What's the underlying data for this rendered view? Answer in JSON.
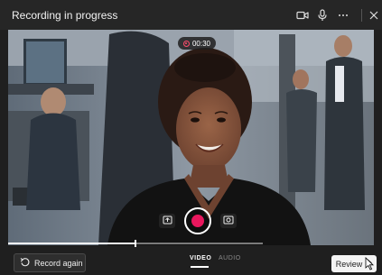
{
  "window": {
    "title": "Recording in progress"
  },
  "toolbar": {
    "icons": [
      "camera-icon",
      "microphone-icon",
      "more-icon",
      "close-icon"
    ]
  },
  "recording": {
    "timer": "00:30"
  },
  "controls": {
    "icons": [
      "upload-icon",
      "record-icon",
      "effects-icon"
    ]
  },
  "progress": {
    "fraction": 0.5
  },
  "modes": {
    "video": "VIDEO",
    "audio": "AUDIO",
    "selected": "VIDEO"
  },
  "buttons": {
    "record_again": "Record again",
    "review": "Review"
  },
  "colors": {
    "accent": "#e8175d",
    "background": "#1f1f1f"
  }
}
